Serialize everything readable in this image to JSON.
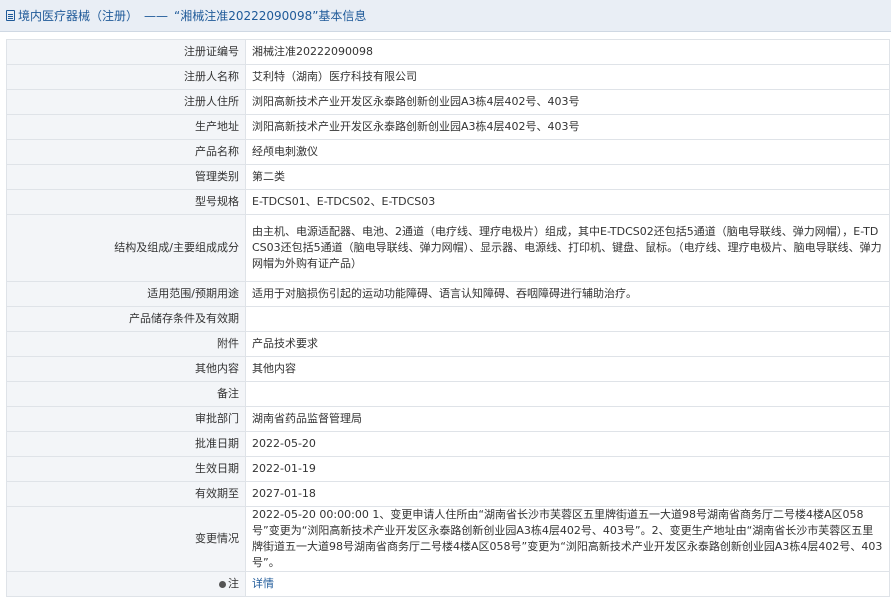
{
  "header": {
    "category": "境内医疗器械（注册）",
    "separator": "——",
    "title": "“湘械注准20222090098”基本信息"
  },
  "rows": [
    {
      "label": "注册证编号",
      "value": "湘械注准20222090098"
    },
    {
      "label": "注册人名称",
      "value": "艾利特（湖南）医疗科技有限公司"
    },
    {
      "label": "注册人住所",
      "value": "浏阳高新技术产业开发区永泰路创新创业园A3栋4层402号、403号"
    },
    {
      "label": "生产地址",
      "value": "浏阳高新技术产业开发区永泰路创新创业园A3栋4层402号、403号"
    },
    {
      "label": "产品名称",
      "value": "经颅电刺激仪"
    },
    {
      "label": "管理类别",
      "value": "第二类"
    },
    {
      "label": "型号规格",
      "value": "E-TDCS01、E-TDCS02、E-TDCS03"
    },
    {
      "label": "结构及组成/主要组成成分",
      "value": "由主机、电源适配器、电池、2通道（电疗线、理疗电极片）组成，其中E-TDCS02还包括5通道（脑电导联线、弹力网帽），E-TDCS03还包括5通道（脑电导联线、弹力网帽）、显示器、电源线、打印机、键盘、鼠标。（电疗线、理疗电极片、脑电导联线、弹力网帽为外购有证产品）"
    },
    {
      "label": "适用范围/预期用途",
      "value": "适用于对脑损伤引起的运动功能障碍、语言认知障碍、吞咽障碍进行辅助治疗。"
    },
    {
      "label": "产品储存条件及有效期",
      "value": ""
    },
    {
      "label": "附件",
      "value": "产品技术要求"
    },
    {
      "label": "其他内容",
      "value": "其他内容"
    },
    {
      "label": "备注",
      "value": ""
    },
    {
      "label": "审批部门",
      "value": "湖南省药品监督管理局"
    },
    {
      "label": "批准日期",
      "value": "2022-05-20"
    },
    {
      "label": "生效日期",
      "value": "2022-01-19"
    },
    {
      "label": "有效期至",
      "value": "2027-01-18"
    },
    {
      "label": "变更情况",
      "value": "2022-05-20 00:00:00 1、变更申请人住所由“湖南省长沙市芙蓉区五里牌街道五一大道98号湖南省商务厅二号楼4楼A区058号”变更为“浏阳高新技术产业开发区永泰路创新创业园A3栋4层402号、403号”。2、变更生产地址由“湖南省长沙市芙蓉区五里牌街道五一大道98号湖南省商务厅二号楼4楼A区058号”变更为“浏阳高新技术产业开发区永泰路创新创业园A3栋4层402号、403号”。"
    }
  ],
  "note": {
    "label": "注",
    "link": "详情",
    "icon": "note-icon"
  }
}
